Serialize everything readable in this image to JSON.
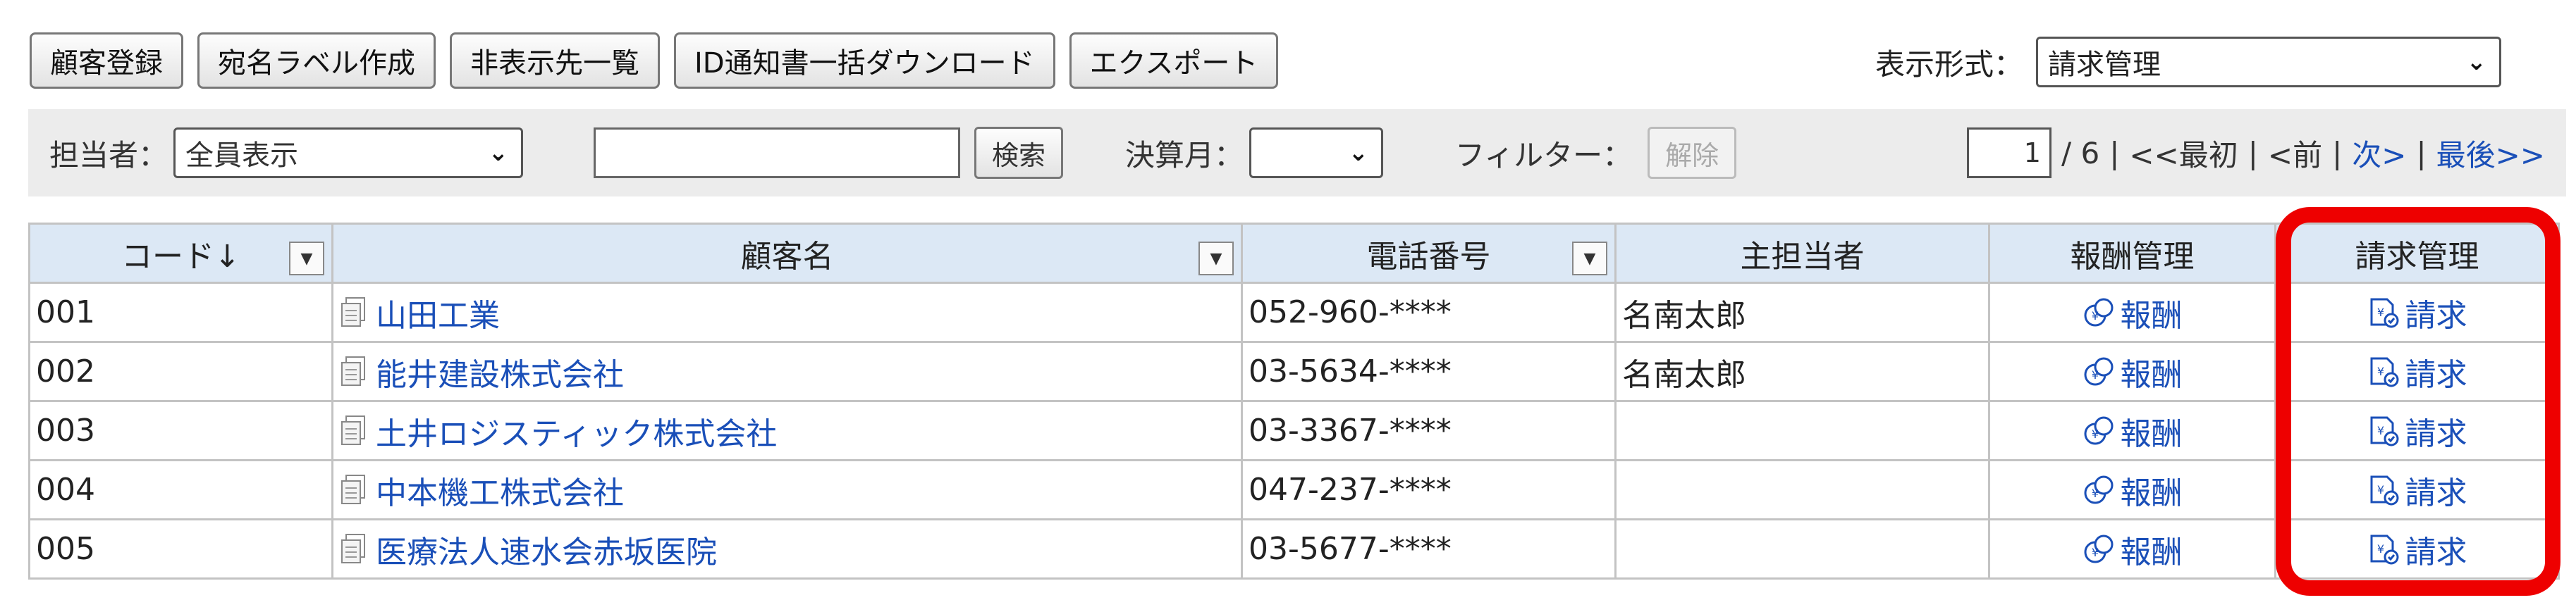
{
  "toolbar": {
    "buttons": [
      "顧客登録",
      "宛名ラベル作成",
      "非表示先一覧",
      "ID通知書一括ダウンロード",
      "エクスポート"
    ]
  },
  "view_format": {
    "label": "表示形式：",
    "value": "請求管理"
  },
  "filter": {
    "assignee_label": "担当者：",
    "assignee_value": "全員表示",
    "search_value": "",
    "search_button": "検索",
    "fiscal_month_label": "決算月：",
    "fiscal_month_value": "",
    "filter_label": "フィルター：",
    "clear_button": "解除"
  },
  "pager": {
    "current_page": "1",
    "total": "/ 6",
    "sep": "|",
    "first": "<<最初",
    "prev": "<前",
    "next": "次>",
    "last": "最後>>"
  },
  "table": {
    "headers": [
      "コード↓",
      "顧客名",
      "電話番号",
      "主担当者",
      "報酬管理",
      "請求管理"
    ],
    "rows": [
      {
        "code": "001",
        "name": "山田工業",
        "phone": "052-960-****",
        "owner": "名南太郎",
        "fee": "報酬",
        "billing": "請求"
      },
      {
        "code": "002",
        "name": "能井建設株式会社",
        "phone": "03-5634-****",
        "owner": "名南太郎",
        "fee": "報酬",
        "billing": "請求"
      },
      {
        "code": "003",
        "name": "土井ロジスティック株式会社",
        "phone": "03-3367-****",
        "owner": "",
        "fee": "報酬",
        "billing": "請求"
      },
      {
        "code": "004",
        "name": "中本機工株式会社",
        "phone": "047-237-****",
        "owner": "",
        "fee": "報酬",
        "billing": "請求"
      },
      {
        "code": "005",
        "name": "医療法人速水会赤坂医院",
        "phone": "03-5677-****",
        "owner": "",
        "fee": "報酬",
        "billing": "請求"
      }
    ]
  },
  "colors": {
    "link": "#1a4fb8",
    "header_bg": "#dce8f5",
    "highlight": "#ee0000",
    "filterbar_bg": "#ececec"
  },
  "icons": {
    "customer": "document-icon",
    "fee": "yen-coin-icon",
    "billing": "invoice-check-icon"
  }
}
